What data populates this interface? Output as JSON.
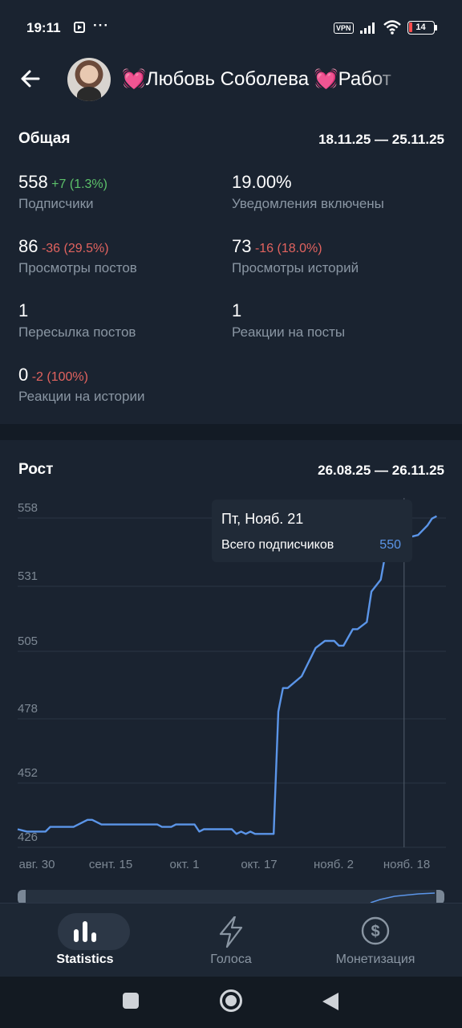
{
  "status_bar": {
    "time": "19:11",
    "dots": "···",
    "vpn": "VPN",
    "battery": "14",
    "battery_color": "#ff4d4d"
  },
  "header": {
    "title": "💓Любовь Соболева 💓Работ"
  },
  "overview": {
    "title": "Общая",
    "range": "18.11.25 — 25.11.25",
    "metrics": [
      {
        "value": "558",
        "delta": "+7 (1.3%)",
        "trend": "up",
        "label": "Подписчики"
      },
      {
        "value": "19.00%",
        "delta": "",
        "trend": "none",
        "label": "Уведомления включены"
      },
      {
        "value": "86",
        "delta": "-36 (29.5%)",
        "trend": "down",
        "label": "Просмотры постов"
      },
      {
        "value": "73",
        "delta": "-16 (18.0%)",
        "trend": "down",
        "label": "Просмотры историй"
      },
      {
        "value": "1",
        "delta": "",
        "trend": "none",
        "label": "Пересылка постов"
      },
      {
        "value": "1",
        "delta": "",
        "trend": "none",
        "label": "Реакции на посты"
      },
      {
        "value": "0",
        "delta": "-2 (100%)",
        "trend": "down",
        "label": "Реакции на истории"
      }
    ]
  },
  "growth": {
    "title": "Рост",
    "range": "26.08.25 — 26.11.25",
    "tooltip": {
      "date": "Пт, Нояб. 21",
      "label": "Всего подписчиков",
      "value": "550"
    }
  },
  "chart_data": {
    "type": "line",
    "y_ticks": [
      "558",
      "531",
      "505",
      "478",
      "452",
      "426"
    ],
    "x_ticks": [
      "авг. 30",
      "сент. 15",
      "окт. 1",
      "окт. 17",
      "нояб. 2",
      "нояб. 18"
    ],
    "ylim": [
      418,
      562
    ],
    "xlim": [
      0,
      92
    ],
    "line_color": "#5b95e8",
    "grid": true,
    "series": [
      {
        "values": [
          [
            0,
            425
          ],
          [
            2,
            424
          ],
          [
            6,
            424
          ],
          [
            7,
            426
          ],
          [
            12,
            426
          ],
          [
            15,
            429
          ],
          [
            16,
            429
          ],
          [
            18,
            427
          ],
          [
            30,
            427
          ],
          [
            31,
            426
          ],
          [
            33,
            426
          ],
          [
            34,
            427
          ],
          [
            38,
            427
          ],
          [
            39,
            424
          ],
          [
            40,
            425
          ],
          [
            46,
            425
          ],
          [
            47,
            423
          ],
          [
            48,
            424
          ],
          [
            49,
            423
          ],
          [
            50,
            424
          ],
          [
            51,
            423
          ],
          [
            55,
            423
          ],
          [
            56,
            475
          ],
          [
            57,
            485
          ],
          [
            58,
            485
          ],
          [
            61,
            490
          ],
          [
            64,
            502
          ],
          [
            66,
            505
          ],
          [
            68,
            505
          ],
          [
            69,
            503
          ],
          [
            70,
            503
          ],
          [
            72,
            510
          ],
          [
            73,
            510
          ],
          [
            75,
            513
          ],
          [
            76,
            526
          ],
          [
            78,
            531
          ],
          [
            79,
            542
          ],
          [
            80,
            546
          ],
          [
            81,
            548
          ],
          [
            82,
            549
          ],
          [
            83,
            550
          ],
          [
            84,
            549
          ],
          [
            86,
            550
          ],
          [
            88,
            554
          ],
          [
            89,
            557
          ],
          [
            90,
            558
          ]
        ]
      }
    ],
    "highlight": {
      "x": 83,
      "y": 550
    }
  },
  "bottom_nav": [
    {
      "label": "Statistics",
      "icon": "bar-chart-icon",
      "active": true
    },
    {
      "label": "Голоса",
      "icon": "lightning-icon",
      "active": false
    },
    {
      "label": "Монетизация",
      "icon": "dollar-coin-icon",
      "active": false
    }
  ]
}
